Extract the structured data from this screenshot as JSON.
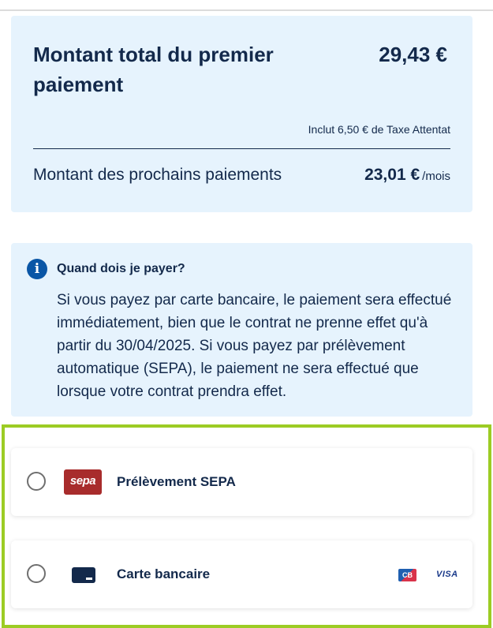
{
  "summary": {
    "title": "Montant total du premier paiement",
    "amount": "29,43 €",
    "tax_note": "Inclut 6,50 € de Taxe Attentat",
    "next_label": "Montant des prochains paiements",
    "next_amount": "23,01 €",
    "next_unit": "/mois"
  },
  "info": {
    "icon": "info-icon",
    "glyph": "i",
    "title": "Quand dois je payer?",
    "text": "Si vous payez par carte bancaire, le paiement sera effectué immédiatement, bien que le contrat ne prenne effet qu'à partir du 30/04/2025. Si vous payez par prélèvement automatique (SEPA), le paiement ne sera effectué que lorsque votre contrat prendra effet."
  },
  "payment_options": [
    {
      "label": "Prélèvement SEPA",
      "selected": false,
      "icon": "sepa-logo",
      "logo_text": "sepa"
    },
    {
      "label": "Carte bancaire",
      "selected": false,
      "icon": "credit-card-icon",
      "brands": [
        {
          "name": "cb-logo",
          "text": "CB"
        },
        {
          "name": "visa-logo",
          "text": "VISA"
        }
      ]
    }
  ],
  "colors": {
    "navy_text": "#13294b",
    "panel_bg": "#e6f3fd",
    "info_icon": "#0a56a6",
    "highlight_border": "#9ccc24",
    "sepa_red": "#a82c2c"
  }
}
